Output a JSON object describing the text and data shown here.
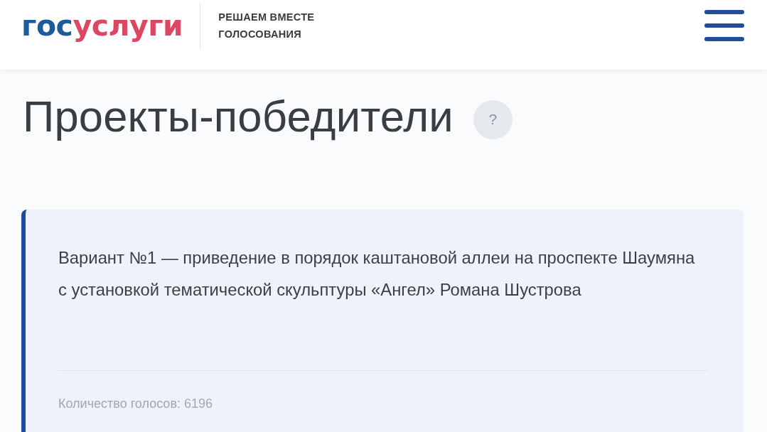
{
  "header": {
    "logo": [
      {
        "text": "гос",
        "color": "#1c5c9a"
      },
      {
        "text": "услуги",
        "color": "#dc4862"
      }
    ],
    "subtitle_lines": [
      "РЕШАЕМ ВМЕСТЕ",
      "ГОЛОСОВАНИЯ"
    ]
  },
  "page_title": "Проекты-победители",
  "help_button": {
    "label": "?"
  },
  "projects": [
    {
      "title": "Вариант №1 — приведение в порядок каштановой аллеи на проспекте Шаумяна с установкой тематической скульптуры «Ангел» Романа Шустрова",
      "votes": "Количество голосов: 6196"
    }
  ]
}
